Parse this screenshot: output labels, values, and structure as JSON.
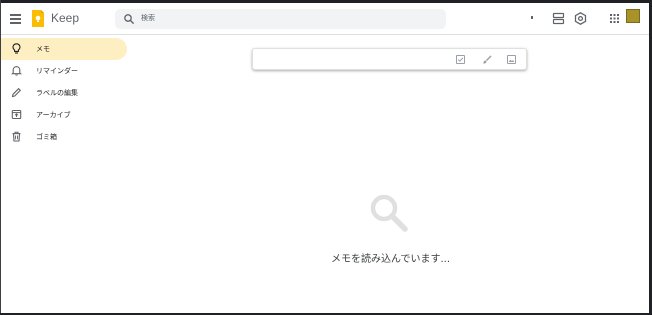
{
  "app": {
    "title": "Keep"
  },
  "search": {
    "placeholder": "検索"
  },
  "header": {
    "icons": [
      "menu-icon",
      "search-icon",
      "list-view-icon",
      "settings-icon",
      "apps-icon",
      "avatar"
    ],
    "avatar_color": "#a8922a"
  },
  "sidebar": {
    "items": [
      {
        "label": "メモ",
        "icon": "lightbulb-icon",
        "active": true
      },
      {
        "label": "リマインダー",
        "icon": "bell-icon",
        "active": false
      },
      {
        "label": "ラベルの編集",
        "icon": "pencil-icon",
        "active": false
      },
      {
        "label": "アーカイブ",
        "icon": "archive-icon",
        "active": false
      },
      {
        "label": "ゴミ箱",
        "icon": "trash-icon",
        "active": false
      }
    ]
  },
  "note_bar": {
    "icons": [
      "checkbox-icon",
      "brush-icon",
      "image-icon"
    ]
  },
  "main": {
    "loading_text": "メモを読み込んでいます..."
  },
  "colors": {
    "active_item": "#feefc3",
    "logo": "#fbbc04",
    "icon": "#5f6368",
    "loading_icon": "#e0e0e0"
  }
}
